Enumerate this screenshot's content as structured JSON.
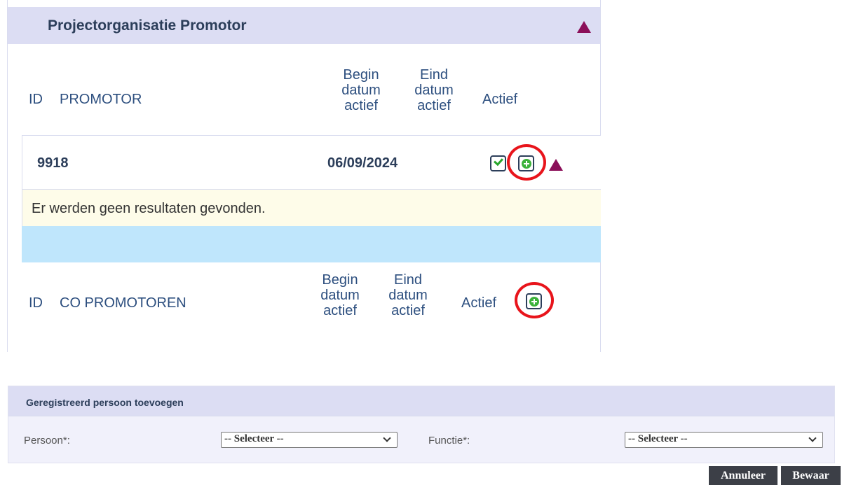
{
  "panel": {
    "title": "Projectorganisatie Promotor",
    "promotor_table": {
      "col_id": "ID",
      "col_name": "PROMOTOR",
      "col_begin": [
        "Begin",
        "datum",
        "actief"
      ],
      "col_end": [
        "Eind",
        "datum",
        "actief"
      ],
      "col_active": "Actief"
    },
    "promotor_row": {
      "id": "9918",
      "begin_date": "06/09/2024",
      "active_checked": true
    },
    "empty_message": "Er werden geen resultaten gevonden.",
    "co_table": {
      "col_id": "ID",
      "col_name": "CO PROMOTOREN",
      "col_begin": [
        "Begin",
        "datum",
        "actief"
      ],
      "col_end": [
        "Eind",
        "datum",
        "actief"
      ],
      "col_active": "Actief"
    }
  },
  "form": {
    "title": "Geregistreerd persoon toevoegen",
    "person_label": "Persoon*:",
    "person_selected": "-- Selecteer --",
    "function_label": "Functie*:",
    "function_selected": "-- Selecteer --"
  },
  "buttons": {
    "cancel": "Annuleer",
    "save": "Bewaar"
  },
  "colors": {
    "header_bg": "#dcddf3",
    "accent_triangle": "#8b0f59",
    "highlight_ring": "#e8141b",
    "empty_bg": "#fefce9",
    "blue_bar": "#bfe6fc",
    "button_bg": "#3c3f47"
  },
  "icons": [
    "collapse-triangle-icon",
    "checkbox-checked-icon",
    "add-plus-icon"
  ]
}
